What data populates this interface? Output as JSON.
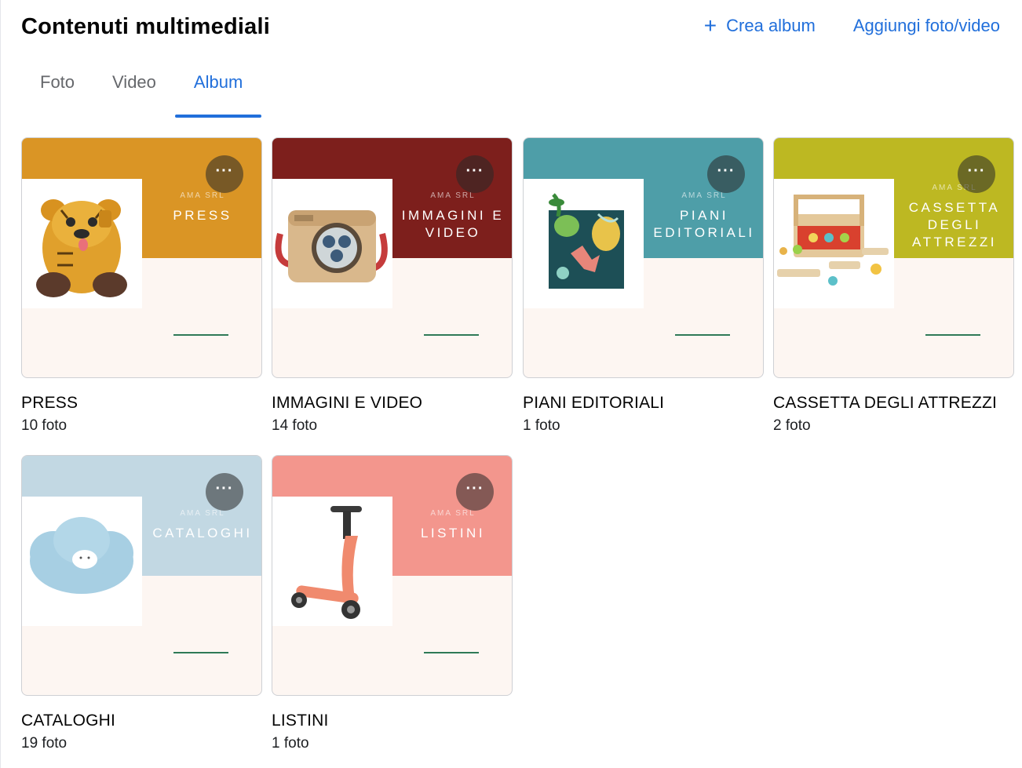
{
  "header": {
    "title": "Contenuti multimediali",
    "create_album": "Crea album",
    "add_media": "Aggiungi foto/video"
  },
  "tabs": [
    "Foto",
    "Video",
    "Album"
  ],
  "active_tab": "Album",
  "cover_brand": "AMA SRL",
  "albums": [
    {
      "cover_title_lines": [
        "PRESS"
      ],
      "name": "PRESS",
      "count": "10 foto",
      "band_color": "#da9525",
      "photo": "backpack"
    },
    {
      "cover_title_lines": [
        "IMMAGINI E",
        "VIDEO"
      ],
      "name": "IMMAGINI E VIDEO",
      "count": "14 foto",
      "band_color": "#7d1f1c",
      "photo": "camera"
    },
    {
      "cover_title_lines": [
        "PIANI",
        "EDITORIALI"
      ],
      "name": "PIANI EDITORIALI",
      "count": "1 foto",
      "band_color": "#4e9ea8",
      "photo": "book"
    },
    {
      "cover_title_lines": [
        "CASSETTA",
        "DEGLI",
        "ATTREZZI"
      ],
      "name": "CASSETTA DEGLI ATTREZZI",
      "count": "2 foto",
      "band_color": "#bdb822",
      "photo": "toolbox"
    },
    {
      "cover_title_lines": [
        "CATALOGHI"
      ],
      "name": "CATALOGHI",
      "count": "19 foto",
      "band_color": "#c2d8e3",
      "photo": "cloud"
    },
    {
      "cover_title_lines": [
        "LISTINI"
      ],
      "name": "LISTINI",
      "count": "1 foto",
      "band_color": "#f3968d",
      "photo": "scooter"
    }
  ]
}
